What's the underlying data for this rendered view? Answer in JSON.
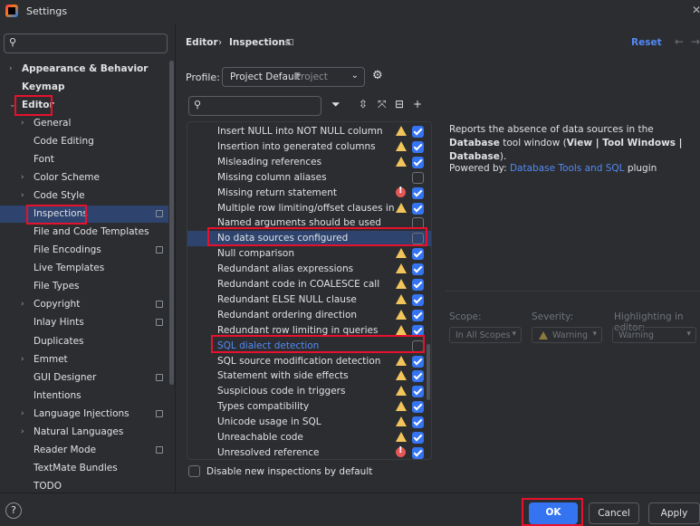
{
  "window": {
    "title": "Settings"
  },
  "sidebar": {
    "items": [
      {
        "label": "Appearance & Behavior",
        "bold": true,
        "chevron": "›"
      },
      {
        "label": "Keymap",
        "bold": true
      },
      {
        "label": "Editor",
        "bold": true,
        "chevron": "⌄"
      },
      {
        "label": "General",
        "chevron": "›"
      },
      {
        "label": "Code Editing"
      },
      {
        "label": "Font"
      },
      {
        "label": "Color Scheme",
        "chevron": "›"
      },
      {
        "label": "Code Style",
        "chevron": "›"
      },
      {
        "label": "Inspections",
        "selected": true,
        "project": true
      },
      {
        "label": "File and Code Templates"
      },
      {
        "label": "File Encodings",
        "project": true
      },
      {
        "label": "Live Templates"
      },
      {
        "label": "File Types"
      },
      {
        "label": "Copyright",
        "chevron": "›",
        "project": true
      },
      {
        "label": "Inlay Hints",
        "project": true
      },
      {
        "label": "Duplicates"
      },
      {
        "label": "Emmet",
        "chevron": "›"
      },
      {
        "label": "GUI Designer",
        "project": true
      },
      {
        "label": "Intentions"
      },
      {
        "label": "Language Injections",
        "chevron": "›",
        "project": true
      },
      {
        "label": "Natural Languages",
        "chevron": "›"
      },
      {
        "label": "Reader Mode",
        "project": true
      },
      {
        "label": "TextMate Bundles"
      },
      {
        "label": "TODO"
      }
    ]
  },
  "header": {
    "breadcrumb_editor": "Editor",
    "breadcrumb_sep": "›",
    "breadcrumb_inspections": "Inspections",
    "reset": "Reset",
    "nav_back": "←",
    "nav_forward": "→"
  },
  "profile": {
    "label": "Profile:",
    "value": "Project Default",
    "scope": "Project"
  },
  "inspections": [
    {
      "name": "Insert NULL into NOT NULL column",
      "severity": "warning",
      "checked": true
    },
    {
      "name": "Insertion into generated columns",
      "severity": "warning",
      "checked": true
    },
    {
      "name": "Misleading references",
      "severity": "warning",
      "checked": true
    },
    {
      "name": "Missing column aliases",
      "severity": "",
      "checked": false
    },
    {
      "name": "Missing return statement",
      "severity": "error",
      "checked": true
    },
    {
      "name": "Multiple row limiting/offset clauses in querie",
      "severity": "warning",
      "checked": true
    },
    {
      "name": "Named arguments should be used",
      "severity": "",
      "checked": false
    },
    {
      "name": "No data sources configured",
      "severity": "",
      "checked": false,
      "selected": true
    },
    {
      "name": "Null comparison",
      "severity": "warning",
      "checked": true
    },
    {
      "name": "Redundant alias expressions",
      "severity": "warning",
      "checked": true
    },
    {
      "name": "Redundant code in COALESCE call",
      "severity": "warning",
      "checked": true
    },
    {
      "name": "Redundant ELSE NULL clause",
      "severity": "warning",
      "checked": true
    },
    {
      "name": "Redundant ordering direction",
      "severity": "warning",
      "checked": true
    },
    {
      "name": "Redundant row limiting in queries",
      "severity": "warning",
      "checked": true
    },
    {
      "name": "SQL dialect detection",
      "severity": "",
      "checked": false,
      "link": true
    },
    {
      "name": "SQL source modification detection",
      "severity": "warning",
      "checked": true
    },
    {
      "name": "Statement with side effects",
      "severity": "warning",
      "checked": true
    },
    {
      "name": "Suspicious code in triggers",
      "severity": "warning",
      "checked": true
    },
    {
      "name": "Types compatibility",
      "severity": "warning",
      "checked": true
    },
    {
      "name": "Unicode usage in SQL",
      "severity": "warning",
      "checked": true
    },
    {
      "name": "Unreachable code",
      "severity": "warning",
      "checked": true
    },
    {
      "name": "Unresolved reference",
      "severity": "error",
      "checked": true
    }
  ],
  "description": {
    "line1_a": "Reports the absence of data sources in the ",
    "line1_b": "Database",
    "line1_c": " tool window (",
    "line1_d": "View | Tool Windows | Database",
    "line1_e": ").",
    "powered_prefix": "Powered by: ",
    "powered_link": "Database Tools and SQL",
    "powered_suffix": " plugin"
  },
  "options": {
    "scope_label": "Scope:",
    "severity_label": "Severity:",
    "highlighting_label": "Highlighting in editor:",
    "scope_value": "In All Scopes",
    "severity_value": "Warning",
    "highlighting_value": "Warning"
  },
  "footer": {
    "disable_new": "Disable new inspections by default",
    "help": "?",
    "ok": "OK",
    "cancel": "Cancel",
    "apply": "Apply"
  },
  "colors": {
    "accent": "#3574f0",
    "link": "#548af7",
    "selection": "#2e436e",
    "highlight_box": "#e8112d",
    "warning": "#f2c55c",
    "error": "#e55757"
  }
}
